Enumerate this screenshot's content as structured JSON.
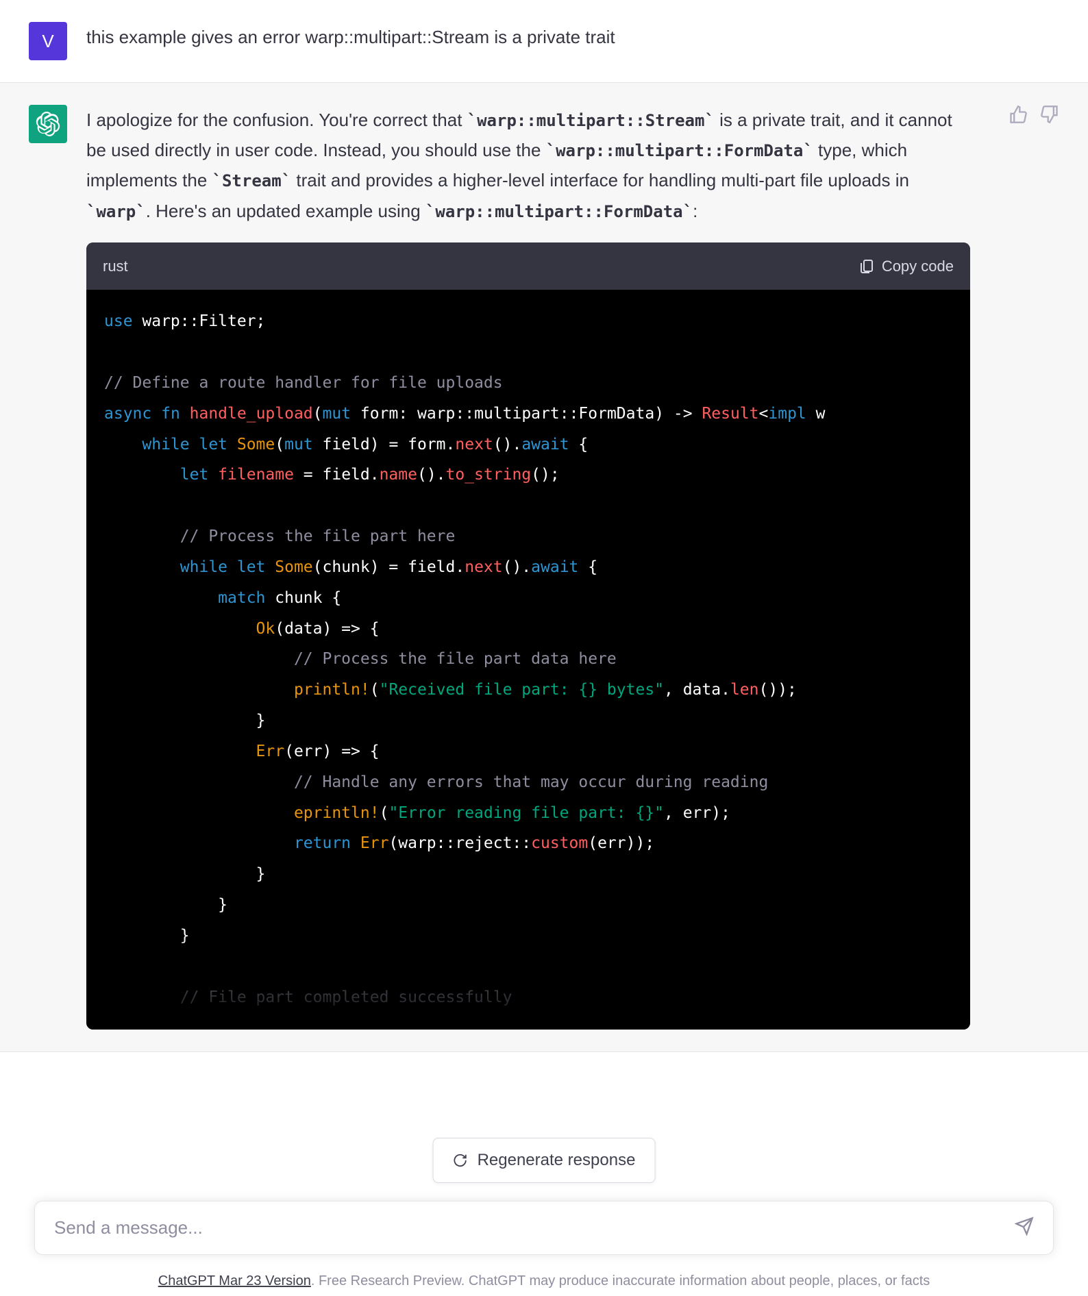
{
  "user": {
    "avatar_letter": "V",
    "message": "this example gives an error warp::multipart::Stream is a private trait"
  },
  "assistant": {
    "text": {
      "p1_a": "I apologize for the confusion. You're correct that ",
      "code1": "`warp::multipart::Stream`",
      "p1_b": " is a private trait, and it cannot be used directly in user code. Instead, you should use the ",
      "code2": "`warp::multipart::FormData`",
      "p1_c": " type, which implements the ",
      "code3": "`Stream`",
      "p1_d": " trait and provides a higher-level interface for handling multi-part file uploads in ",
      "code4": "`warp`",
      "p1_e": ". Here's an updated example using ",
      "code5": "`warp::multipart::FormData`",
      "p1_f": ":"
    }
  },
  "code": {
    "lang": "rust",
    "copy_label": "Copy code",
    "lines": {
      "l1a": "use",
      "l1b": " warp::Filter;",
      "l2": "",
      "l3": "// Define a route handler for file uploads",
      "l4a": "async",
      "l4b": " fn",
      "l4c": " handle_upload",
      "l4d": "(",
      "l4e": "mut",
      "l4f": " form: warp::multipart::FormData) -> ",
      "l4g": "Result",
      "l4h": "<",
      "l4i": "impl",
      "l4j": " w",
      "l5a": "    while",
      "l5b": " let",
      "l5c": " Some",
      "l5d": "(",
      "l5e": "mut",
      "l5f": " field) = form.",
      "l5g": "next",
      "l5h": "().",
      "l5i": "await",
      "l5j": " {",
      "l6a": "        let",
      "l6b": " filename",
      "l6c": " = field.",
      "l6d": "name",
      "l6e": "().",
      "l6f": "to_string",
      "l6g": "();",
      "l7": "",
      "l8": "        // Process the file part here",
      "l9a": "        while",
      "l9b": " let",
      "l9c": " Some",
      "l9d": "(chunk) = field.",
      "l9e": "next",
      "l9f": "().",
      "l9g": "await",
      "l9h": " {",
      "l10a": "            match",
      "l10b": " chunk {",
      "l11a": "                Ok",
      "l11b": "(data) => {",
      "l12": "                    // Process the file part data here",
      "l13a": "                    println!",
      "l13b": "(",
      "l13c": "\"Received file part: {} bytes\"",
      "l13d": ", data.",
      "l13e": "len",
      "l13f": "());",
      "l14": "                }",
      "l15a": "                Err",
      "l15b": "(err) => {",
      "l16": "                    // Handle any errors that may occur during reading",
      "l17a": "                    eprintln!",
      "l17b": "(",
      "l17c": "\"Error reading file part: {}\"",
      "l17d": ", err);",
      "l18a": "                    return",
      "l18b": " Err",
      "l18c": "(warp::reject::",
      "l18d": "custom",
      "l18e": "(err));",
      "l19": "                }",
      "l20": "            }",
      "l21": "        }",
      "l22": "",
      "l23": "        // File part completed successfully"
    }
  },
  "regen_label": "Regenerate response",
  "input_placeholder": "Send a message...",
  "footer": {
    "version": "ChatGPT Mar 23 Version",
    "rest": ". Free Research Preview. ChatGPT may produce inaccurate information about people, places, or facts"
  }
}
